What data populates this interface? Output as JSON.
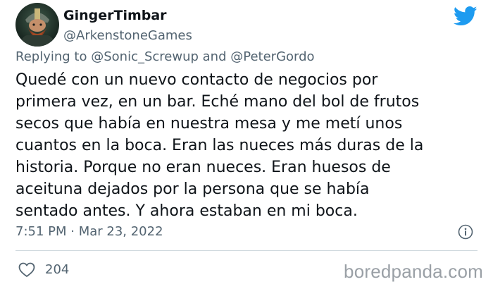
{
  "user": {
    "name": "GingerTimbar",
    "handle": "@ArkenstoneGames",
    "avatar_icon": "dwarf-avatar-icon"
  },
  "reply": {
    "prefix": "Replying to",
    "mention1": "@Sonic_Screwup",
    "conjunction": "and",
    "mention2": "@PeterGordo"
  },
  "tweet": {
    "text": "Quedé con un nuevo contacto de negocios por\nprimera vez, en un bar. Eché mano del bol de frutos\nsecos que había en nuestra mesa y me metí unos\ncuantos en la boca. Eran las nueces más duras de la\nhistoria. Porque no eran nueces. Eran huesos de\naceituna dejados por la persona que se había\nsentado antes. Y ahora estaban en mi boca."
  },
  "meta": {
    "timestamp": "7:51 PM · Mar 23, 2022"
  },
  "stats": {
    "likes": "204"
  },
  "watermark": {
    "text": "boredpanda.com"
  },
  "colors": {
    "twitter_blue": "#1d9bf0",
    "secondary_text": "#536471",
    "primary_text": "#0f1419"
  }
}
